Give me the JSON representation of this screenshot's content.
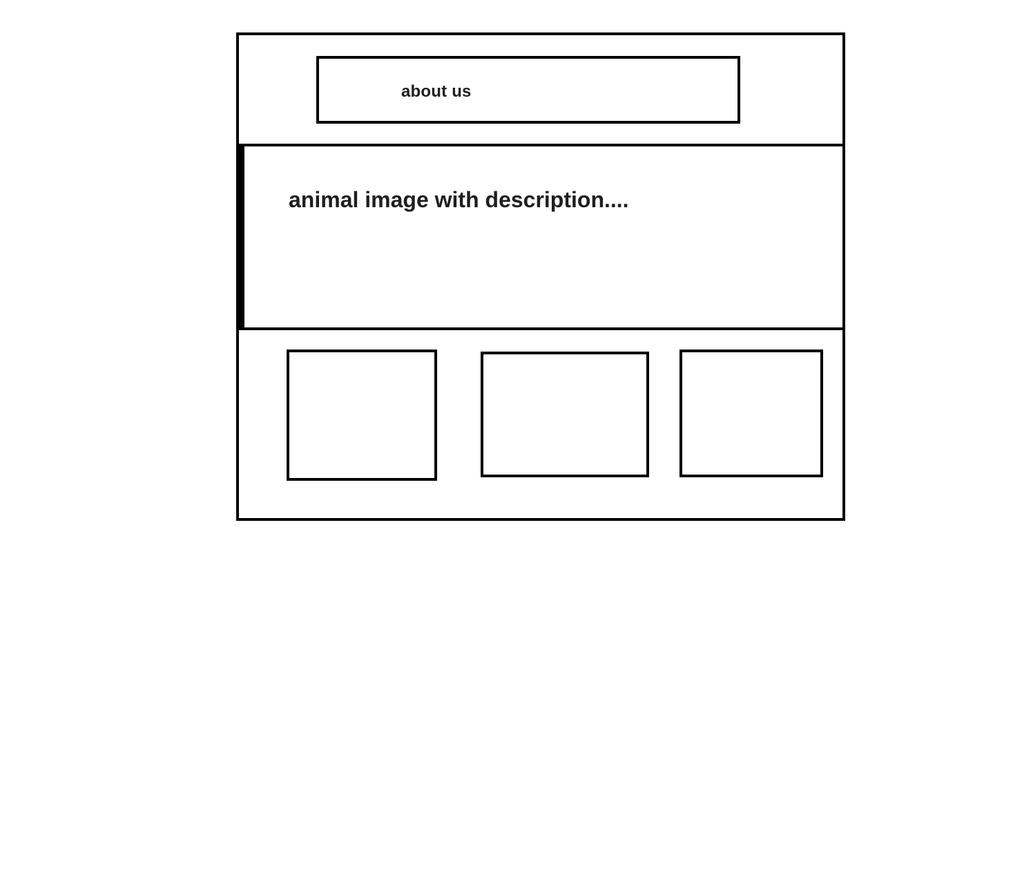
{
  "header": {
    "nav_label": "about us"
  },
  "hero": {
    "text": "animal image with description...."
  },
  "gallery": {
    "items": [
      {
        "label": ""
      },
      {
        "label": ""
      },
      {
        "label": ""
      }
    ]
  }
}
